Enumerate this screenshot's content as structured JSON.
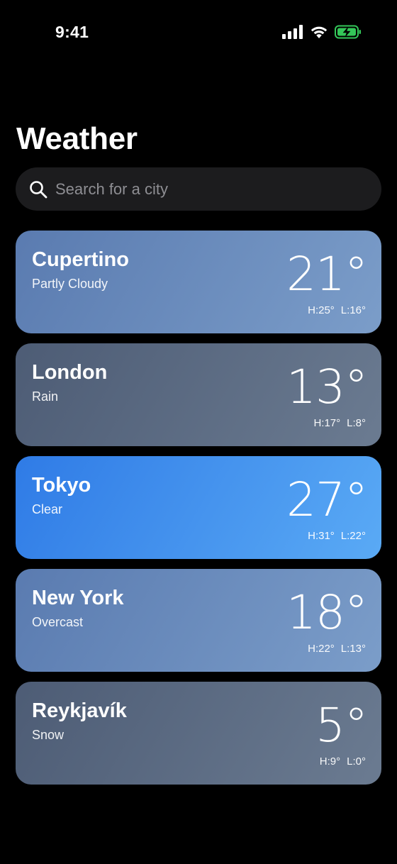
{
  "status_bar": {
    "time": "9:41",
    "icons": [
      "cellular-signal-icon",
      "wifi-icon",
      "battery-charging-icon"
    ],
    "battery_color": "#34c759"
  },
  "header": {
    "title": "Weather"
  },
  "search": {
    "placeholder": "Search for a city",
    "value": ""
  },
  "cities": [
    {
      "name": "Cupertino",
      "condition": "Partly Cloudy",
      "temp": "21°",
      "high": "H:25°",
      "low": "L:16°",
      "gradient": [
        "#5a7bb0",
        "#7b9dc9"
      ]
    },
    {
      "name": "London",
      "condition": "Rain",
      "temp": "13°",
      "high": "H:17°",
      "low": "L:8°",
      "gradient": [
        "#4d5c75",
        "#6b7b91"
      ]
    },
    {
      "name": "Tokyo",
      "condition": "Clear",
      "temp": "27°",
      "high": "H:31°",
      "low": "L:22°",
      "gradient": [
        "#2f7be6",
        "#5aaaf5"
      ]
    },
    {
      "name": "New York",
      "condition": "Overcast",
      "temp": "18°",
      "high": "H:22°",
      "low": "L:13°",
      "gradient": [
        "#5a7bb0",
        "#7b9dc9"
      ]
    },
    {
      "name": "Reykjavík",
      "condition": "Snow",
      "temp": "5°",
      "high": "H:9°",
      "low": "L:0°",
      "gradient": [
        "#4d5c75",
        "#6b7b91"
      ]
    }
  ]
}
